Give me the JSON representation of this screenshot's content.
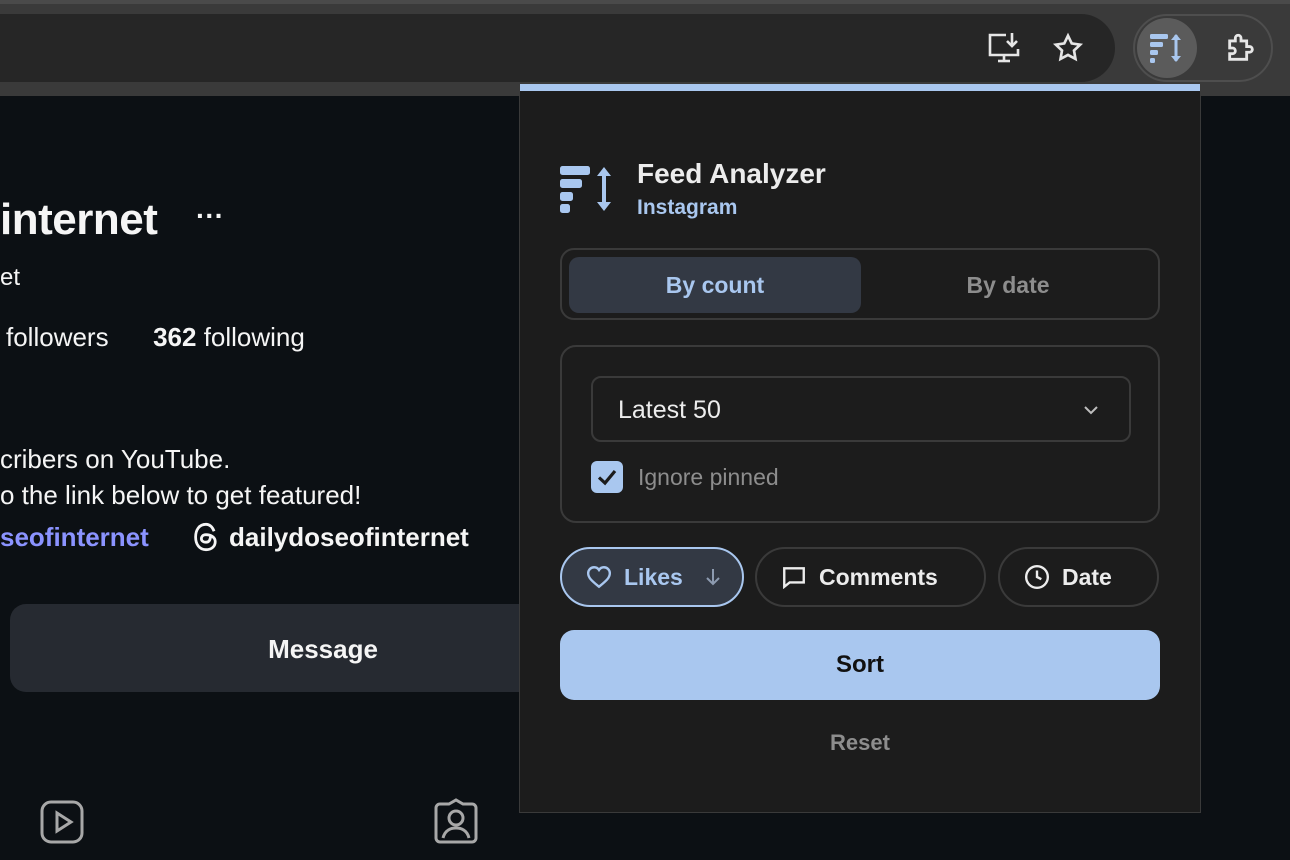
{
  "browser": {
    "install_label": "install-app-icon",
    "bookmark_label": "star-icon",
    "extension_icon": "feed-analyzer-icon",
    "extensions_icon": "puzzle-icon"
  },
  "profile": {
    "name": "internet",
    "more": "···",
    "subtitle": "et",
    "followers_label": "followers",
    "following_count": "362",
    "following_label": "following",
    "bio_line1": "cribers on YouTube.",
    "bio_line2": "o the link below to get featured!",
    "link1": "seofinternet",
    "threads_handle": "dailydoseofinternet",
    "message_button": "Message"
  },
  "popup": {
    "title": "Feed Analyzer",
    "platform": "Instagram",
    "mode_tabs": [
      "By count",
      "By date"
    ],
    "active_mode": "By count",
    "count_select_value": "Latest 50",
    "ignore_pinned_label": "Ignore pinned",
    "ignore_pinned_checked": true,
    "sort_fields": [
      {
        "label": "Likes",
        "icon": "heart-icon",
        "active": true,
        "direction": "descending"
      },
      {
        "label": "Comments",
        "icon": "comment-icon",
        "active": false
      },
      {
        "label": "Date",
        "icon": "clock-icon",
        "active": false
      }
    ],
    "sort_button": "Sort",
    "reset_link": "Reset"
  },
  "colors": {
    "accent": "#a9c7ef",
    "popup_bg": "#1c1c1c",
    "page_bg": "#0c1014",
    "link": "#8b93ff"
  }
}
